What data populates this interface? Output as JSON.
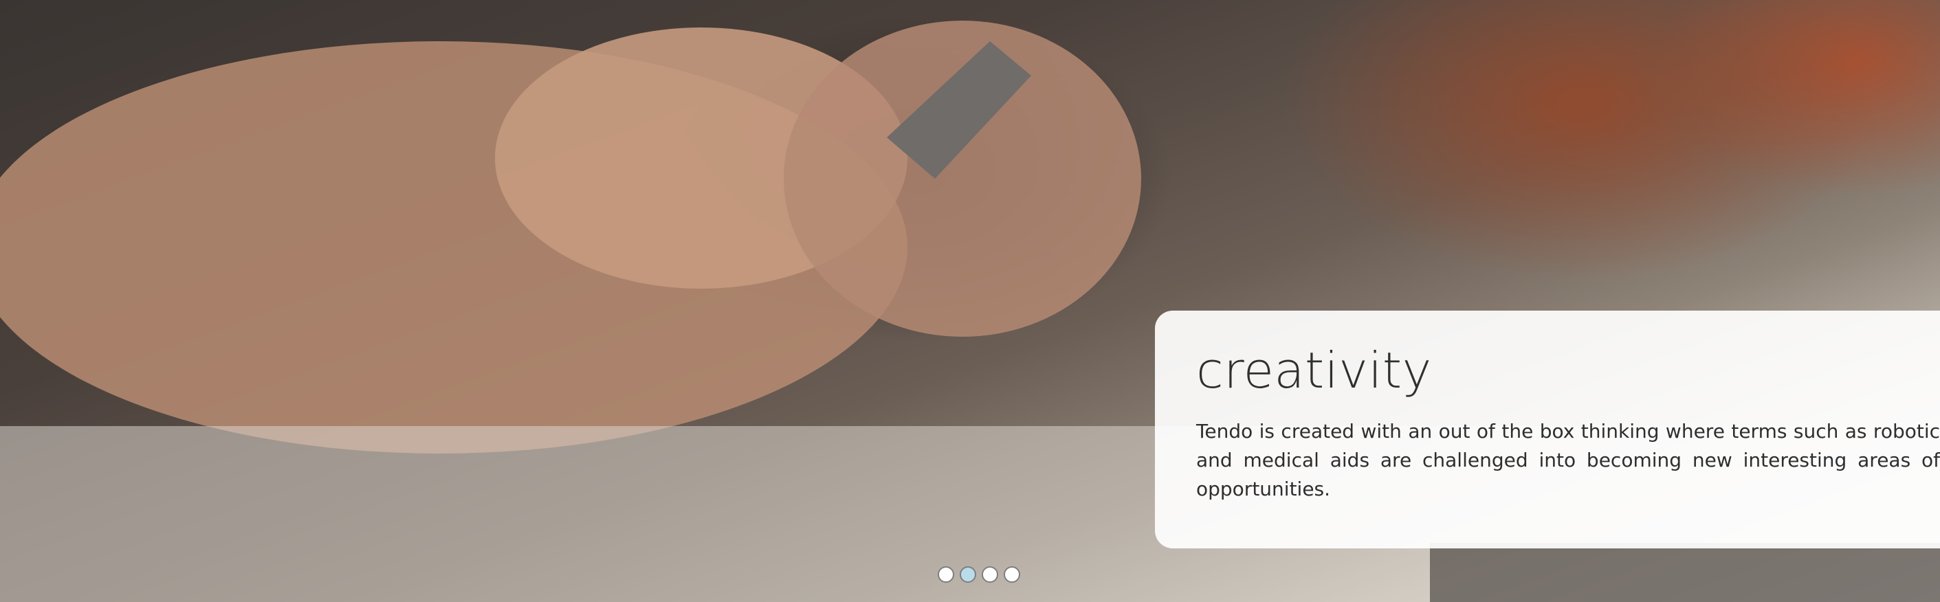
{
  "slide": {
    "title": "creativity",
    "text": "Tendo is created with an out of the box thinking where terms such as robotic and medical aids are challenged into becoming new interesting areas of opportunities."
  },
  "carousel": {
    "total_slides": 4,
    "active_index": 1,
    "active_color": "#b9dcea",
    "inactive_color": "#ffffff"
  },
  "background_image": {
    "icon": "photo-hands-assembling-part"
  }
}
